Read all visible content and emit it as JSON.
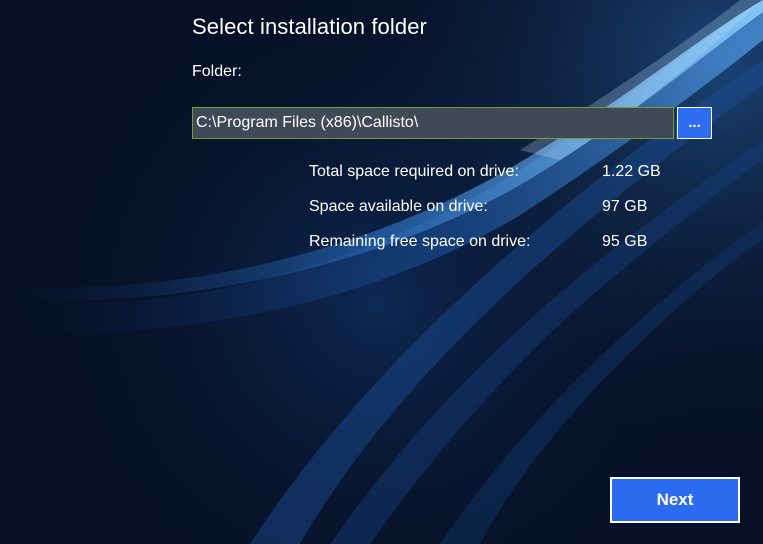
{
  "header": {
    "title": "Select installation folder"
  },
  "folder": {
    "label": "Folder:",
    "value": "C:\\Program Files (x86)\\Callisto\\",
    "browse_label": "..."
  },
  "space_info": {
    "rows": [
      {
        "label": "Total space required on drive:",
        "value": "1.22 GB"
      },
      {
        "label": "Space available on drive:",
        "value": "97 GB"
      },
      {
        "label": "Remaining free space on drive:",
        "value": "95 GB"
      }
    ]
  },
  "footer": {
    "next_label": "Next"
  },
  "colors": {
    "background": "#071026",
    "accent": "#2c6bf0",
    "input_background": "#3f4a56",
    "input_border": "#7a9a3a"
  }
}
